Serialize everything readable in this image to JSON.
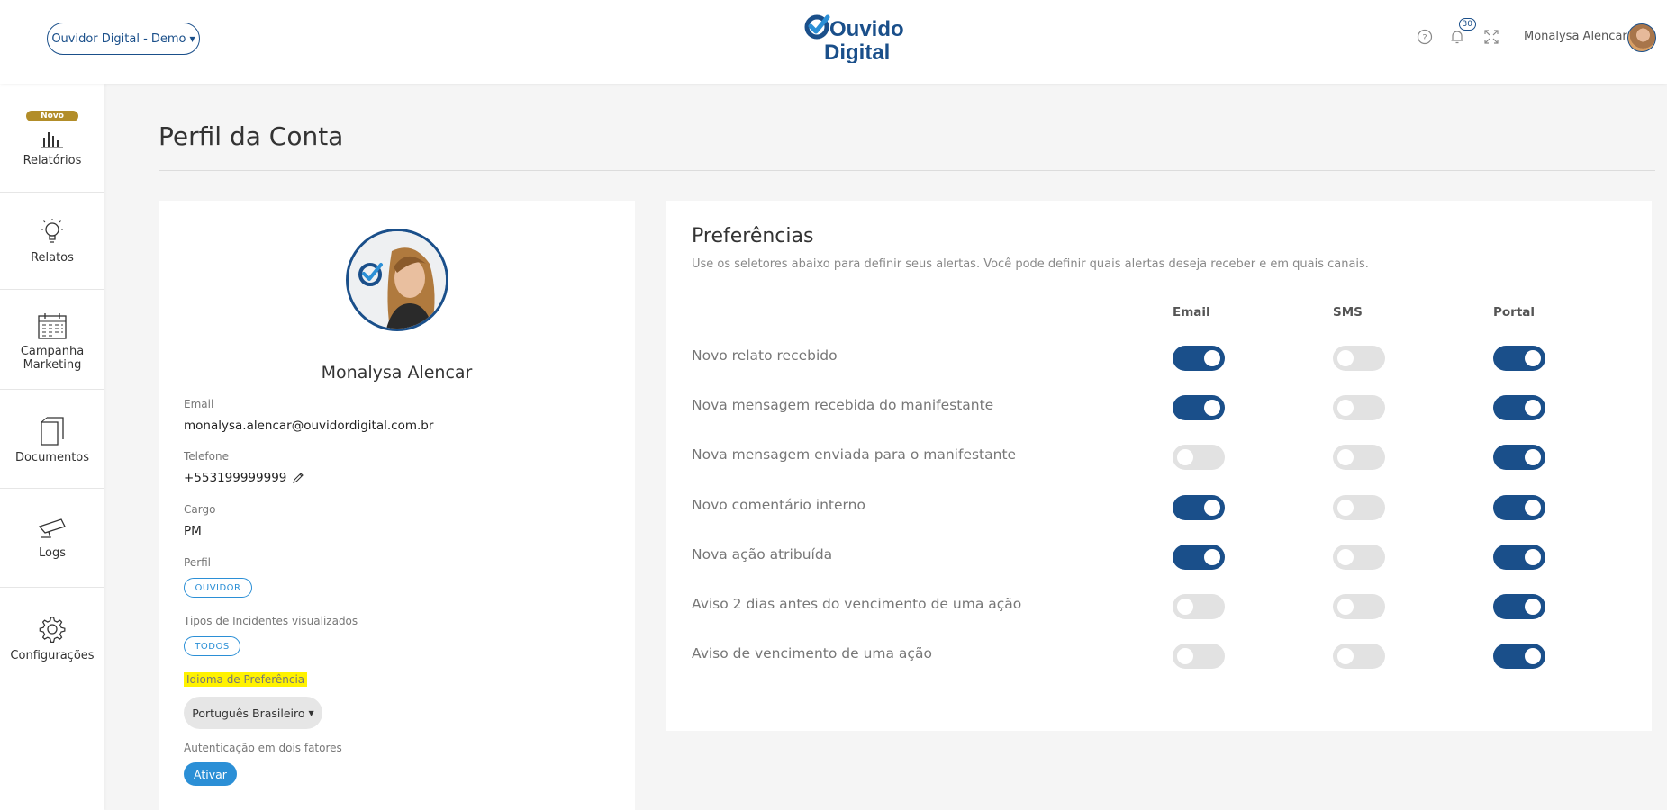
{
  "header": {
    "org_select_label": "Ouvidor Digital - Demo",
    "logo_top": "Ouvidor",
    "logo_bottom": "Digital",
    "notification_count": "30",
    "user_name": "Monalysa Alencar"
  },
  "sidebar": {
    "new_badge": "Novo",
    "items": [
      {
        "label": "Relatórios",
        "icon": "bar-chart-icon"
      },
      {
        "label": "Relatos",
        "icon": "lightbulb-icon"
      },
      {
        "label": "Campanha Marketing",
        "icon": "calendar-icon"
      },
      {
        "label": "Documentos",
        "icon": "documents-icon"
      },
      {
        "label": "Logs",
        "icon": "camera-icon"
      },
      {
        "label": "Configurações",
        "icon": "gear-icon"
      }
    ]
  },
  "page": {
    "title": "Perfil da Conta"
  },
  "profile": {
    "name": "Monalysa Alencar",
    "email_label": "Email",
    "email": "monalysa.alencar@ouvidordigital.com.br",
    "phone_label": "Telefone",
    "phone": "+553199999999",
    "role_label": "Cargo",
    "role": "PM",
    "profile_label": "Perfil",
    "profile_value": "OUVIDOR",
    "incident_types_label": "Tipos de Incidentes visualizados",
    "incident_types_value": "TODOS",
    "language_label": "Idioma de Preferência",
    "language_value": "Português Brasileiro",
    "twofa_label": "Autenticação em dois fatores",
    "twofa_button": "Ativar"
  },
  "preferences": {
    "title": "Preferências",
    "description": "Use os seletores abaixo para definir seus alertas. Você pode definir quais alertas deseja receber e em quais canais.",
    "columns": [
      "Email",
      "SMS",
      "Portal"
    ],
    "rows": [
      {
        "label": "Novo relato recebido",
        "email": true,
        "sms": false,
        "portal": true
      },
      {
        "label": "Nova mensagem recebida do manifestante",
        "email": true,
        "sms": false,
        "portal": true
      },
      {
        "label": "Nova mensagem enviada para o manifestante",
        "email": false,
        "sms": false,
        "portal": true
      },
      {
        "label": "Novo comentário interno",
        "email": true,
        "sms": false,
        "portal": true
      },
      {
        "label": "Nova ação atribuída",
        "email": true,
        "sms": false,
        "portal": true
      },
      {
        "label": "Aviso 2 dias antes do vencimento de uma ação",
        "email": false,
        "sms": false,
        "portal": true
      },
      {
        "label": "Aviso de vencimento de uma ação",
        "email": false,
        "sms": false,
        "portal": true
      }
    ]
  },
  "colors": {
    "brand_navy": "#1a4f8a",
    "accent_blue": "#2b8fd6",
    "badge_gold": "#b28d29",
    "highlight_yellow": "#fff200"
  }
}
